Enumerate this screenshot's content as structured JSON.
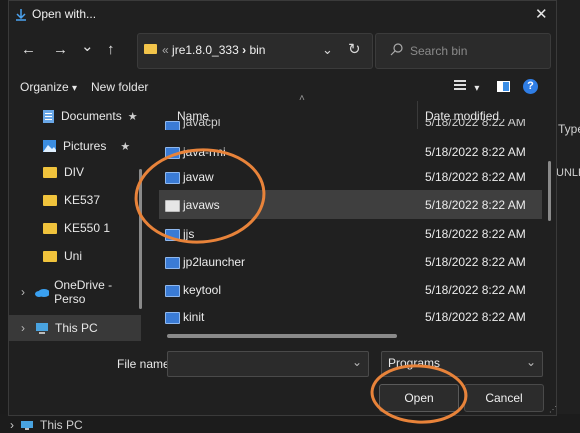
{
  "dialog": {
    "title": "Open with...",
    "close_glyph": "✕"
  },
  "nav": {
    "back": "←",
    "forward": "→",
    "recent": "⌄",
    "up": "↑"
  },
  "address": {
    "prefix": "«",
    "path": "jre1.8.0_333",
    "separator": "›",
    "current": "bin",
    "chevron": "⌄",
    "refresh": "↻"
  },
  "search": {
    "placeholder": "Search bin"
  },
  "toolbar": {
    "organize": "Organize",
    "organize_arrow": "▾",
    "new_folder": "New folder",
    "view_arrow": "▾",
    "help": "?"
  },
  "sidebar": {
    "items": [
      {
        "label": "Documents",
        "icon": "documents-icon",
        "pinned": true
      },
      {
        "label": "Pictures",
        "icon": "pictures-icon",
        "pinned": true
      },
      {
        "label": "DIV",
        "icon": "folder-icon"
      },
      {
        "label": "KE537",
        "icon": "folder-icon"
      },
      {
        "label": "KE550 1",
        "icon": "folder-icon"
      },
      {
        "label": "Uni",
        "icon": "folder-icon"
      },
      {
        "label": "OneDrive - Perso",
        "icon": "onedrive-icon",
        "expand": "›"
      },
      {
        "label": "This PC",
        "icon": "this-pc-icon",
        "expand": "›"
      }
    ],
    "pin_glyph": "★"
  },
  "files": {
    "columns": {
      "name": "Name",
      "date": "Date modified",
      "sort_glyph": "˄"
    },
    "rows": [
      {
        "name": "javacpl",
        "date": "5/18/2022 8:22 AM",
        "partial": true
      },
      {
        "name": "java-rmi",
        "date": "5/18/2022 8:22 AM"
      },
      {
        "name": "javaw",
        "date": "5/18/2022 8:22 AM"
      },
      {
        "name": "javaws",
        "date": "5/18/2022 8:22 AM",
        "selected": true
      },
      {
        "name": "jjs",
        "date": "5/18/2022 8:22 AM"
      },
      {
        "name": "jp2launcher",
        "date": "5/18/2022 8:22 AM"
      },
      {
        "name": "keytool",
        "date": "5/18/2022 8:22 AM"
      },
      {
        "name": "kinit",
        "date": "5/18/2022 8:22 AM"
      }
    ]
  },
  "footer": {
    "file_name_label": "File name:",
    "file_name_value": "",
    "file_type": "Programs",
    "open": "Open",
    "cancel": "Cancel"
  },
  "background": {
    "type_col": "Type",
    "unlp_text": "UNLP",
    "this_pc": "This PC"
  },
  "annotation_color": "#e8833a"
}
